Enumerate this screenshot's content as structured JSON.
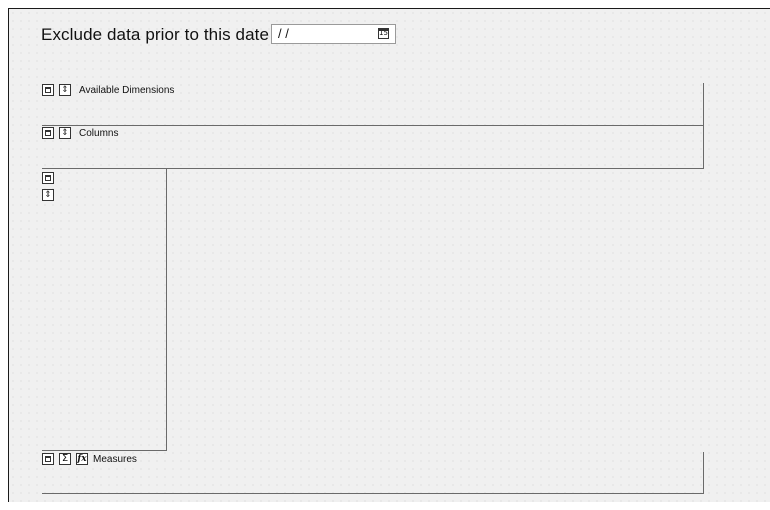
{
  "filter": {
    "label": "Exclude data prior to this date",
    "date_value": "/ /",
    "calendar_icon_text": "15"
  },
  "areas": {
    "available_dimensions": {
      "label": "Available Dimensions"
    },
    "columns": {
      "label": "Columns"
    },
    "measures": {
      "label": "Measures"
    }
  },
  "icons": {
    "window": "window-icon",
    "sort": "sort-updown-icon",
    "sigma": "sum-icon",
    "fx": "function-icon",
    "calendar": "calendar-icon"
  }
}
